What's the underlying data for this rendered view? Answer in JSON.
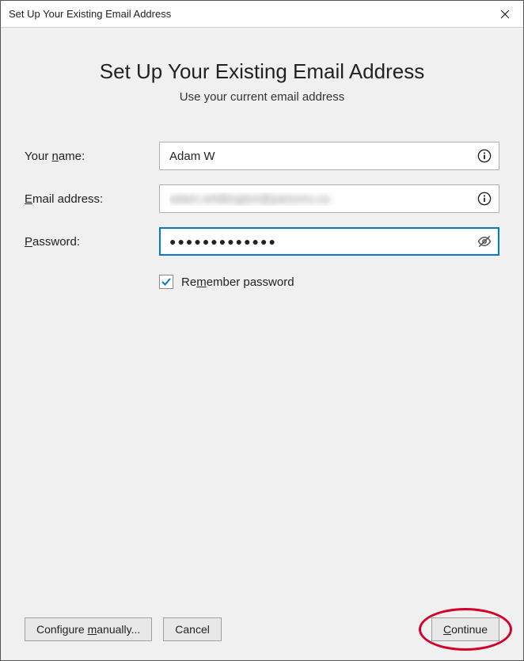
{
  "titlebar": {
    "title": "Set Up Your Existing Email Address"
  },
  "heading": "Set Up Your Existing Email Address",
  "subheading": "Use your current email address",
  "form": {
    "name": {
      "label_pre": "Your ",
      "label_ul": "n",
      "label_post": "ame:",
      "value": "Adam W"
    },
    "email": {
      "label_ul": "E",
      "label_post": "mail address:",
      "value": "adam.whittington@parsons.ca"
    },
    "password": {
      "label_ul": "P",
      "label_post": "assword:",
      "masked": "●●●●●●●●●●●●●"
    },
    "remember": {
      "checked": true,
      "label_pre": "Re",
      "label_ul": "m",
      "label_post": "ember password"
    }
  },
  "buttons": {
    "configure_pre": "Configure ",
    "configure_ul": "m",
    "configure_post": "anually...",
    "cancel": "Cancel",
    "continue_ul": "C",
    "continue_post": "ontinue"
  }
}
